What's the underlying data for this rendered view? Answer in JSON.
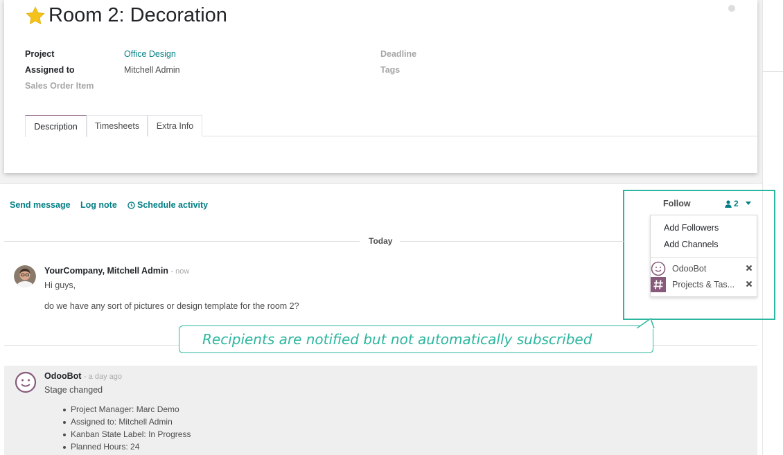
{
  "record": {
    "title": "Room 2: Decoration",
    "fields": {
      "project_label": "Project",
      "project_value": "Office Design",
      "assigned_label": "Assigned to",
      "assigned_value": "Mitchell Admin",
      "sales_order_label": "Sales Order Item",
      "deadline_label": "Deadline",
      "tags_label": "Tags"
    },
    "tabs": [
      {
        "label": "Description",
        "active": true
      },
      {
        "label": "Timesheets",
        "active": false
      },
      {
        "label": "Extra Info",
        "active": false
      }
    ]
  },
  "chatter": {
    "send_message": "Send message",
    "log_note": "Log note",
    "schedule_activity": "Schedule activity",
    "follow": "Follow",
    "followers_count": "2",
    "dropdown": {
      "add_followers": "Add Followers",
      "add_channels": "Add Channels",
      "followers": [
        {
          "name": "OdooBot",
          "icon": "odoobot-avatar"
        },
        {
          "name": "Projects & Tas...",
          "icon": "channel-hash-icon"
        }
      ]
    },
    "day_separator": "Today",
    "messages": [
      {
        "author": "YourCompany, Mitchell Admin",
        "time": "- now",
        "lines": [
          "Hi guys,",
          "do we have any sort of pictures or design template for the room 2?"
        ]
      },
      {
        "author": "OdooBot",
        "time": "- a day ago",
        "lines": [
          "Stage changed"
        ],
        "tracking": [
          "Project Manager: Marc Demo",
          "Assigned to: Mitchell Admin",
          "Kanban State Label: In Progress",
          "Planned Hours: 24"
        ]
      }
    ]
  },
  "callout": {
    "text": "Recipients are notified but not automatically subscribed"
  },
  "colors": {
    "link": "#017e84",
    "highlight": "#2bb69f",
    "brand": "#875a7b",
    "star": "#f3c21b"
  }
}
